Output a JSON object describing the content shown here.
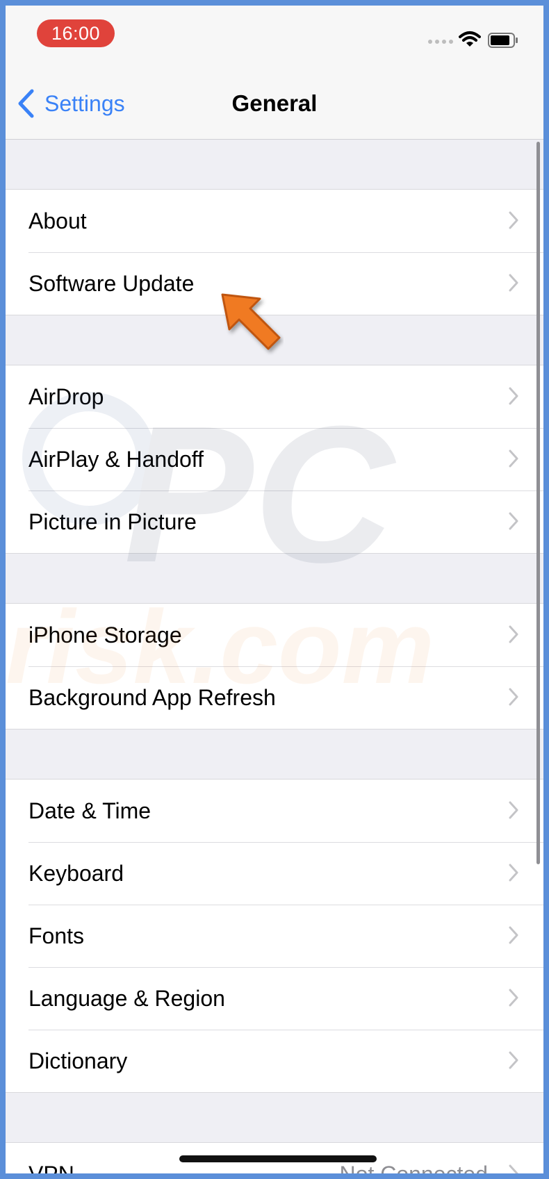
{
  "status_bar": {
    "time": "16:00"
  },
  "nav": {
    "back_label": "Settings",
    "title": "General"
  },
  "groups": [
    {
      "rows": [
        {
          "label": "About"
        },
        {
          "label": "Software Update"
        }
      ]
    },
    {
      "rows": [
        {
          "label": "AirDrop"
        },
        {
          "label": "AirPlay & Handoff"
        },
        {
          "label": "Picture in Picture"
        }
      ]
    },
    {
      "rows": [
        {
          "label": "iPhone Storage"
        },
        {
          "label": "Background App Refresh"
        }
      ]
    },
    {
      "rows": [
        {
          "label": "Date & Time"
        },
        {
          "label": "Keyboard"
        },
        {
          "label": "Fonts"
        },
        {
          "label": "Language & Region"
        },
        {
          "label": "Dictionary"
        }
      ]
    },
    {
      "rows": [
        {
          "label": "VPN",
          "detail": "Not Connected"
        }
      ]
    }
  ],
  "watermark": {
    "line1": "PC",
    "line2": "risk.com"
  },
  "colors": {
    "accent": "#3a82f7",
    "time_pill": "#e0433b",
    "arrow": "#f07a22",
    "frame": "#5b8fd9"
  },
  "icons": {
    "back": "chevron-left-icon",
    "row": "chevron-right-icon",
    "wifi": "wifi-icon",
    "battery": "battery-icon",
    "signal": "cellular-signal-icon",
    "highlight": "orange-pointer-arrow"
  }
}
